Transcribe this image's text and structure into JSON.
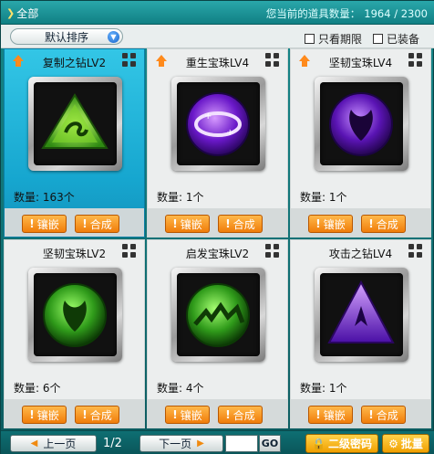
{
  "header": {
    "tab_label": "全部",
    "count_label": "您当前的道具数量：",
    "count_value": "1964 / 2300"
  },
  "filters": {
    "sort_selected": "默认排序",
    "only_timed": "只看期限",
    "equipped": "已装备"
  },
  "items": [
    {
      "name": "复制之钻LV2",
      "qty": "数量: 163个",
      "upgrade": true,
      "selected": true,
      "gem": "green-triangle"
    },
    {
      "name": "重生宝珠LV4",
      "qty": "数量: 1个",
      "upgrade": true,
      "selected": false,
      "gem": "purple-orb-ring"
    },
    {
      "name": "坚韧宝珠LV4",
      "qty": "数量: 1个",
      "upgrade": true,
      "selected": false,
      "gem": "purple-orb-mask"
    },
    {
      "name": "坚韧宝珠LV2",
      "qty": "数量: 6个",
      "upgrade": false,
      "selected": false,
      "gem": "green-orb-mask"
    },
    {
      "name": "启发宝珠LV2",
      "qty": "数量: 4个",
      "upgrade": false,
      "selected": false,
      "gem": "green-orb-wave"
    },
    {
      "name": "攻击之钻LV4",
      "qty": "数量: 1个",
      "upgrade": false,
      "selected": false,
      "gem": "purple-triangle"
    }
  ],
  "item_buttons": {
    "inlay": "镶嵌",
    "combine": "合成"
  },
  "pagination": {
    "prev": "上一页",
    "pages": "1/2",
    "next": "下一页",
    "go": "GO"
  },
  "footer": {
    "password_btn": "二级密码",
    "batch_btn": "批量"
  },
  "colors": {
    "accent": "#16888a",
    "selected": "#22b5da",
    "button": "#f5931b"
  }
}
